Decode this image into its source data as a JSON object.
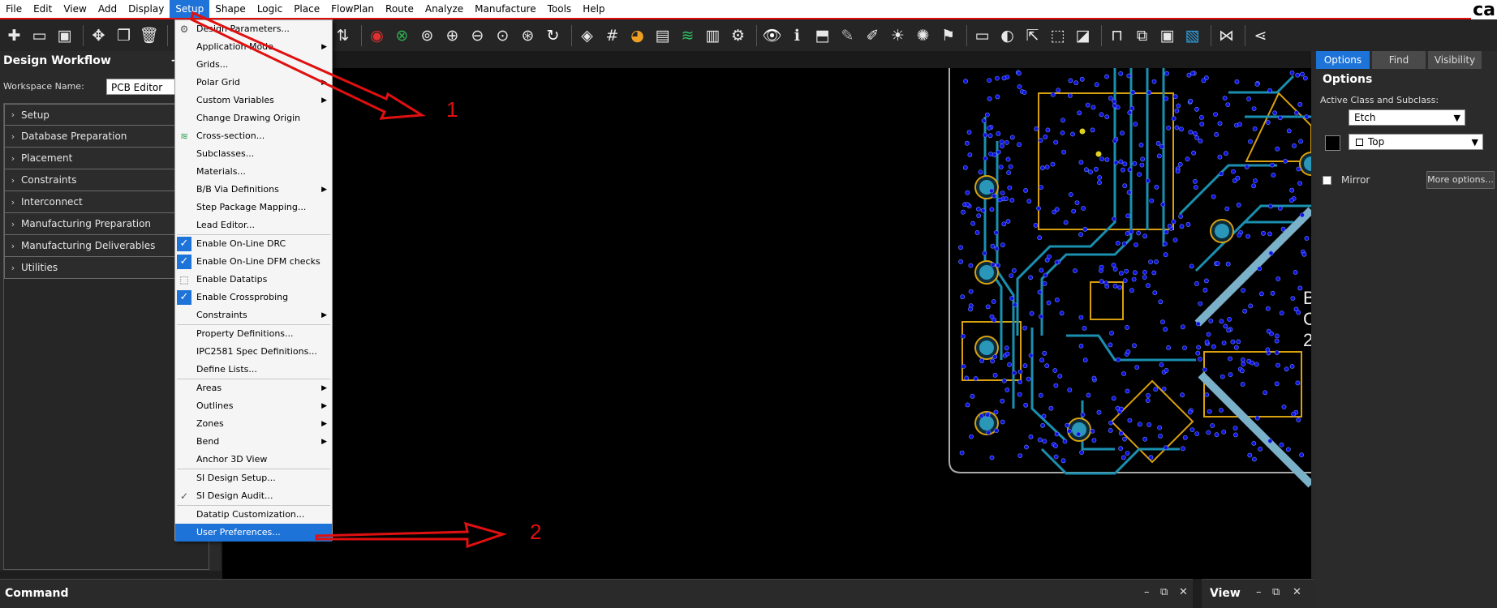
{
  "menubar": {
    "items": [
      "File",
      "Edit",
      "View",
      "Add",
      "Display",
      "Setup",
      "Shape",
      "Logic",
      "Place",
      "FlowPlan",
      "Route",
      "Analyze",
      "Manufacture",
      "Tools",
      "Help"
    ],
    "active": "Setup",
    "brand": "ca"
  },
  "toolbar": {
    "icons": [
      "new-icon",
      "open-icon",
      "save-icon",
      "move-icon",
      "copy-icon",
      "delete-icon",
      "text-icon",
      "add-text-icon",
      "component-icon",
      "chip-icon",
      "add-connect-icon",
      "slide-icon",
      "dimension-icon",
      "drc-icon",
      "cross-icon",
      "zoom-fit-icon",
      "zoom-in-icon",
      "zoom-out-icon",
      "zoom-world-icon",
      "zoom-center-icon",
      "redraw-icon",
      "shape-icon",
      "grid-icon",
      "color-icon",
      "layer-icon",
      "stack-icon",
      "report-icon",
      "settings-icon",
      "visibility-icon",
      "info-icon",
      "measure-icon",
      "highlight-icon",
      "dehighlight-icon",
      "light-icon",
      "constraint-icon",
      "flag-icon",
      "edit-icon",
      "check-icon",
      "align-icon",
      "cursor-icon",
      "bw-icon",
      "pin-icon",
      "snapshot-icon",
      "camera-icon",
      "reporter-icon",
      "export-icon",
      "share-icon"
    ]
  },
  "workflow": {
    "title": "Design Workflow",
    "minimize": "−",
    "workspace_label": "Workspace Name:",
    "workspace_value": "PCB Editor",
    "items": [
      "Setup",
      "Database Preparation",
      "Placement",
      "Constraints",
      "Interconnect",
      "Manufacturing Preparation",
      "Manufacturing Deliverables",
      "Utilities"
    ]
  },
  "setup_menu": {
    "items": [
      {
        "label": "Design Parameters...",
        "submenu": false
      },
      {
        "label": "Application Mode",
        "submenu": true
      },
      {
        "label": "Grids...",
        "submenu": false
      },
      {
        "label": "Polar Grid",
        "submenu": true
      },
      {
        "label": "Custom Variables",
        "submenu": true
      },
      {
        "label": "Change Drawing Origin",
        "submenu": false
      },
      {
        "label": "Cross-section...",
        "submenu": false
      },
      {
        "label": "Subclasses...",
        "submenu": false
      },
      {
        "label": "Materials...",
        "submenu": false
      },
      {
        "label": "B/B Via Definitions",
        "submenu": true
      },
      {
        "label": "Step Package Mapping...",
        "submenu": false
      },
      {
        "label": "Lead Editor...",
        "submenu": false
      },
      {
        "sep": true
      },
      {
        "label": "Enable On-Line DRC",
        "checked": true
      },
      {
        "label": "Enable On-Line DFM checks",
        "checked": true
      },
      {
        "label": "Enable Datatips",
        "checked": false
      },
      {
        "label": "Enable Crossprobing",
        "checked": true
      },
      {
        "label": "Constraints",
        "submenu": true
      },
      {
        "sep": true
      },
      {
        "label": "Property Definitions...",
        "submenu": false
      },
      {
        "label": "IPC2581 Spec Definitions...",
        "submenu": false
      },
      {
        "label": "Define Lists...",
        "submenu": false
      },
      {
        "sep": true
      },
      {
        "label": "Areas",
        "submenu": true
      },
      {
        "label": "Outlines",
        "submenu": true
      },
      {
        "label": "Zones",
        "submenu": true
      },
      {
        "label": "Bend",
        "submenu": true
      },
      {
        "label": "Anchor 3D View",
        "submenu": false
      },
      {
        "sep": true
      },
      {
        "label": "SI Design Setup...",
        "submenu": false
      },
      {
        "label": "SI Design Audit...",
        "submenu": false
      },
      {
        "sep": true
      },
      {
        "label": "Datatip Customization...",
        "submenu": false
      },
      {
        "label": "User Preferences...",
        "submenu": false,
        "highlighted": true
      }
    ]
  },
  "right_panel": {
    "tabs": [
      "Options",
      "Find",
      "Visibility"
    ],
    "active_tab": "Options",
    "title": "Options",
    "active_class_label": "Active Class and Subclass:",
    "class_value": "Etch",
    "subclass_value": "Top",
    "mirror_label": "Mirror",
    "more_options_label": "More options..."
  },
  "board_text": [
    "B",
    "C",
    "2"
  ],
  "command": {
    "title": "Command"
  },
  "view": {
    "title": "View"
  },
  "window_controls": {
    "minimize": "–",
    "restore": "⧉",
    "close": "✕"
  },
  "annotations": {
    "arrow1_label": "1",
    "arrow2_label": "2"
  },
  "colors": {
    "accent": "#1e73d8",
    "annotation": "#e01010",
    "trace": "#1a8fb0",
    "outline": "#d8a010",
    "via": "#1010e0"
  }
}
